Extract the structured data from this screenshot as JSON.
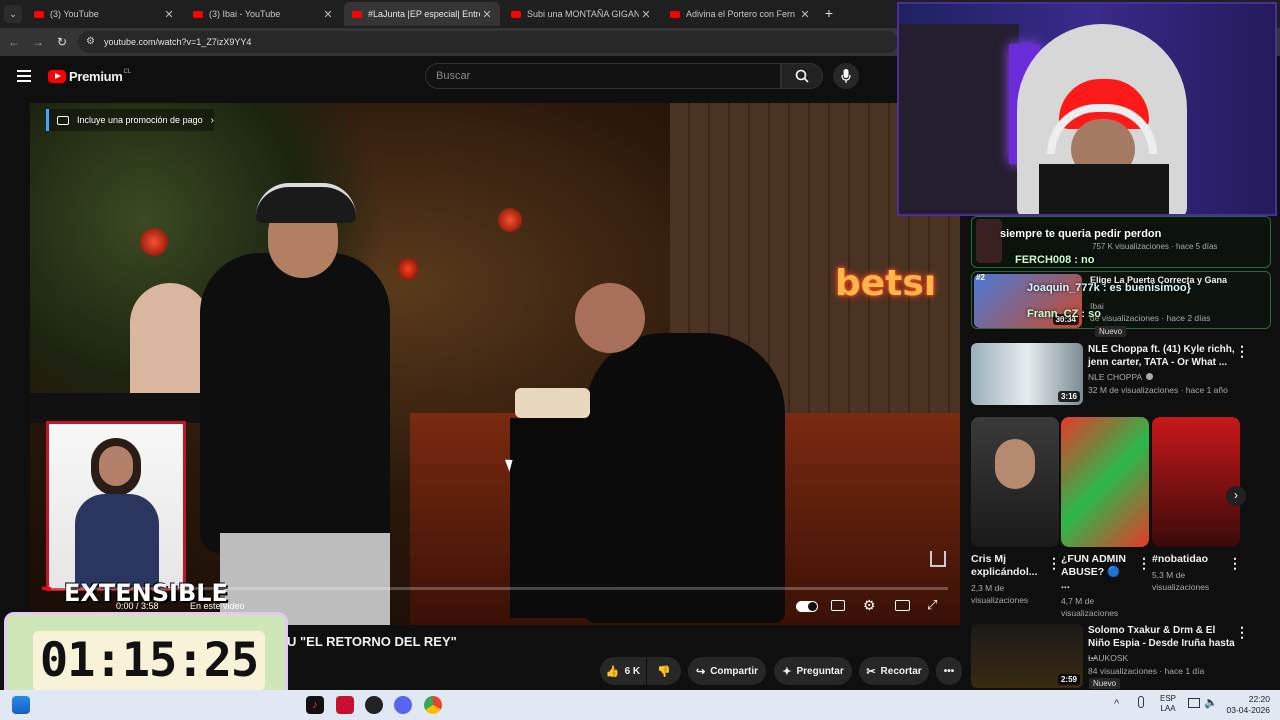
{
  "browser": {
    "tabs": [
      {
        "title": "(3) YouTube",
        "active": false
      },
      {
        "title": "(3) Ibai - YouTube",
        "active": false
      },
      {
        "title": "#LaJunta |EP especial| Entrevista",
        "active": true
      },
      {
        "title": "Subi una MONTAÑA GIGANTE",
        "active": false
      },
      {
        "title": "Adivina el Portero con Fern",
        "active": false
      }
    ],
    "url": "youtube.com/watch?v=1_Z7izX9YY4"
  },
  "youtube": {
    "logo_text": "Premium",
    "logo_region": "CL",
    "search_placeholder": "Buscar"
  },
  "player": {
    "paid_promo": "Incluye una promoción de pago",
    "watermark": "betsı",
    "overlay_text": "EXTENSIBLE",
    "time_text": "0:00 / 3:58",
    "chapter_text": "En este video"
  },
  "video_title": "U \"EL RETORNO DEL REY\"",
  "actions": {
    "likes": "6 K",
    "share": "Compartir",
    "ask": "Preguntar",
    "clip": "Recortar"
  },
  "chat": [
    {
      "user": "",
      "text": "siempre te queria pedir perdon"
    },
    {
      "user": "FERCH008",
      "text": "no"
    },
    {
      "user": "Joaquin_777k",
      "text": "es buenisimoo}"
    },
    {
      "user": "Frann_CZ",
      "text": "so"
    }
  ],
  "sidebar": {
    "partial_meta_1": "757 K visualizaciones · hace 5 días",
    "partial_title_2": "Elige La Puerta Correcta y Gana",
    "partial_channel_2": "Ibai",
    "partial_meta_2": "de visualizaciones · hace 2 días",
    "partial_dur_2": "30:34",
    "badge_new": "Nuevo",
    "rank_2": "#2",
    "video1": {
      "title": "NLE Choppa ft. (41) Kyle richh, jenn carter, TATA - Or What ...",
      "channel": "NLE CHOPPA",
      "meta": "32 M de visualizaciones · hace 1 año",
      "duration": "3:16"
    },
    "shorts": [
      {
        "title": "Cris Mj explicándol...",
        "views": "2,3 M de visualizaciones"
      },
      {
        "title": "¿FUN ADMIN ABUSE? 🔵 ...",
        "views": "4,7 M de visualizaciones"
      },
      {
        "title": "#nobatidao",
        "views": "5,3 M de visualizaciones"
      }
    ],
    "video2": {
      "title": "Solomo Txakur & Drm & El Niño Espia - Desde Iruña hasta ...",
      "channel": "LAUKOSK",
      "meta": "84 visualizaciones · hace 1 día",
      "duration": "2:59"
    }
  },
  "timer": "01:15:25",
  "taskbar": {
    "lang": "ESP",
    "lang2": "LAA",
    "time": "22:20",
    "date": "03-04-2026"
  }
}
